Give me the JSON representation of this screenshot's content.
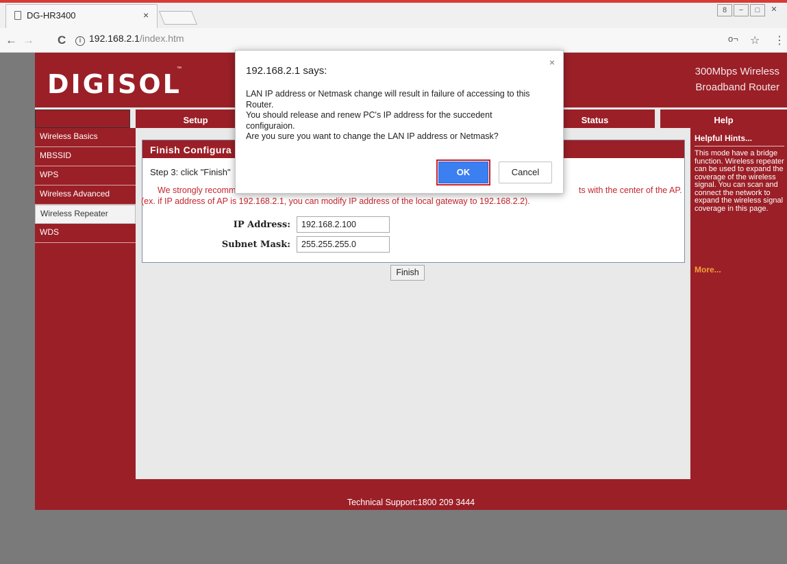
{
  "browser": {
    "tab_title": "DG-HR3400",
    "tab_close": "×",
    "url_host": "192.168.2.1",
    "url_path": "/index.htm",
    "info_icon": "i",
    "back_icon": "←",
    "forward_icon": "→",
    "reload_icon": "C",
    "key_icon": "o¬",
    "star_icon": "☆",
    "menu_icon": "⋮",
    "window_controls": {
      "user": "8",
      "minimize": "−",
      "maximize": "□",
      "close": "✕"
    }
  },
  "router": {
    "logo": "DIGISOL",
    "logo_tm": "™",
    "product_line1": "300Mbps Wireless",
    "product_line2": "Broadband Router",
    "menu": {
      "setup": "Setup",
      "status": "Status",
      "help": "Help"
    },
    "sidebar": [
      {
        "label": "Wireless Basics"
      },
      {
        "label": "MBSSID"
      },
      {
        "label": "WPS"
      },
      {
        "label": "Wireless Advanced"
      },
      {
        "label": "Wireless Repeater"
      },
      {
        "label": "WDS"
      }
    ],
    "panel": {
      "title": "Finish Configura",
      "step": "Step 3: click \"Finish\"",
      "warning_line1_start": "We strongly recomm",
      "warning_line1_end": "ts with the center of the AP.",
      "warning_line2": "(ex. if IP address of AP is 192.168.2.1, you can modify IP address of the local gateway to 192.168.2.2).",
      "ip_label": "IP Address:",
      "ip_value": "192.168.2.100",
      "mask_label": "Subnet Mask:",
      "mask_value": "255.255.255.0",
      "finish_button": "Finish"
    },
    "hints": {
      "title": "Helpful Hints...",
      "text": "This mode have a bridge function. Wireless repeater can be used to expand the coverage of the wireless signal. You can scan and connect the network to expand the wireless signal coverage in this page.",
      "more": "More..."
    },
    "footer": "Technical Support:1800 209 3444"
  },
  "dialog": {
    "title": "192.168.2.1 says:",
    "close": "×",
    "message_lines": [
      "LAN IP address or Netmask change will result in failure of accessing to this",
      "Router.",
      "You should release and renew PC's IP address for the succedent",
      "configuraion.",
      "Are you sure you want to change the LAN IP address or Netmask?"
    ],
    "ok_button": "OK",
    "cancel_button": "Cancel"
  },
  "colors": {
    "brand_red": "#9b1f27",
    "warning_red": "#c4262e",
    "ok_blue": "#3b7ff0",
    "hint_more": "#f2a23a"
  }
}
